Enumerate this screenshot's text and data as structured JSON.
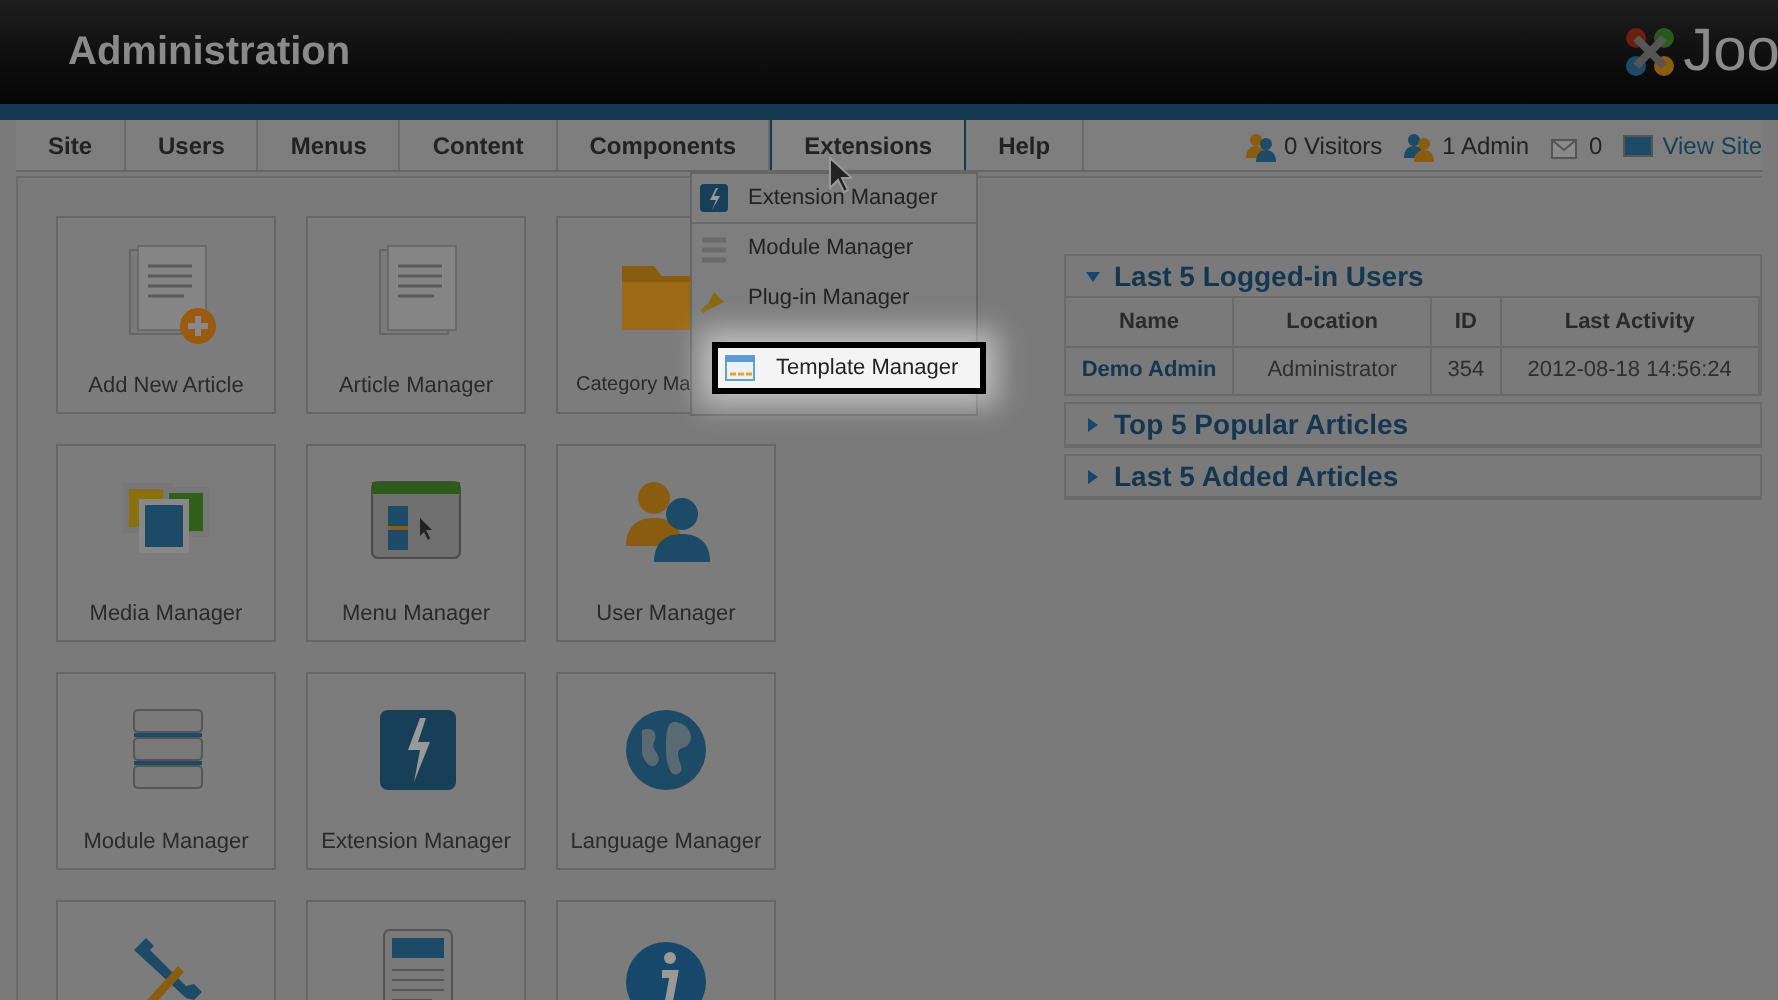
{
  "header": {
    "title": "Administration",
    "logo_text": "Joo"
  },
  "menu": [
    {
      "label": "Site",
      "selected": false
    },
    {
      "label": "Users",
      "selected": false
    },
    {
      "label": "Menus",
      "selected": false
    },
    {
      "label": "Content",
      "selected": false
    },
    {
      "label": "Components",
      "selected": false
    },
    {
      "label": "Extensions",
      "selected": true
    },
    {
      "label": "Help",
      "selected": false
    }
  ],
  "status": [
    {
      "kind": "visitors",
      "text": "0 Visitors"
    },
    {
      "kind": "admins",
      "text": "1 Admin"
    },
    {
      "kind": "messages",
      "text": "0"
    },
    {
      "kind": "site",
      "text": "View Site"
    }
  ],
  "dropdown": [
    {
      "kind": "extension",
      "label": "Extension Manager"
    },
    {
      "kind": "module",
      "label": "Module Manager"
    },
    {
      "kind": "plugin",
      "label": "Plug-in Manager"
    }
  ],
  "callout": {
    "label": "Template Manager"
  },
  "cards": [
    {
      "kind": "article-add",
      "label": "Add New Article"
    },
    {
      "kind": "article",
      "label": "Article Manager"
    },
    {
      "kind": "folder",
      "label": "Category Ma",
      "covered": true
    },
    {
      "kind": "media",
      "label": "Media Manager"
    },
    {
      "kind": "menu",
      "label": "Menu Manager"
    },
    {
      "kind": "users",
      "label": "User Manager"
    },
    {
      "kind": "module",
      "label": "Module Manager"
    },
    {
      "kind": "extension",
      "label": "Extension Manager"
    },
    {
      "kind": "globe",
      "label": "Language Manager"
    },
    {
      "kind": "tools"
    },
    {
      "kind": "template"
    },
    {
      "kind": "info"
    }
  ],
  "panels": [
    {
      "title": "Last 5 Logged-in Users",
      "expanded": true,
      "table": {
        "columns": [
          "Name",
          "Location",
          "ID",
          "Last Activity"
        ],
        "rows": [
          [
            "Demo Admin",
            "Administrator",
            "354",
            "2012-08-18 14:56:24"
          ]
        ]
      }
    },
    {
      "title": "Top 5 Popular Articles",
      "expanded": false
    },
    {
      "title": "Last 5 Added Articles",
      "expanded": false
    }
  ]
}
